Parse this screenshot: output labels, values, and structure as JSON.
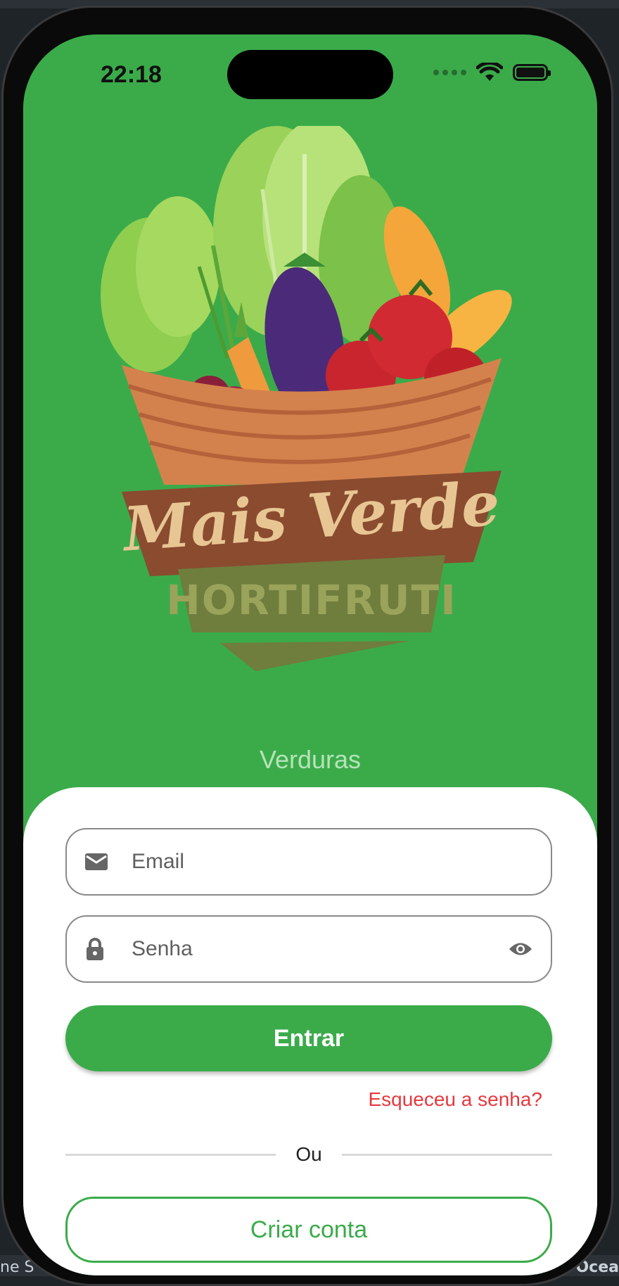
{
  "status": {
    "time": "22:18"
  },
  "logo": {
    "brand": "Mais Verde",
    "subtitle": "HORTIFRUTI"
  },
  "category": "Verduras",
  "form": {
    "email_placeholder": "Email",
    "password_placeholder": "Senha",
    "submit_label": "Entrar",
    "forgot_label": "Esqueceu a senha?",
    "divider_label": "Ou",
    "create_account_label": "Criar conta"
  },
  "background": {
    "left_bottom_text": "ne S",
    "right_bottom_text": "Ocea"
  },
  "colors": {
    "primary_green": "#3bab4a",
    "error_red": "#e5393f",
    "sheet_white": "#ffffff"
  },
  "icons": [
    "mail-icon",
    "lock-icon",
    "eye-icon",
    "wifi-icon",
    "battery-icon"
  ]
}
